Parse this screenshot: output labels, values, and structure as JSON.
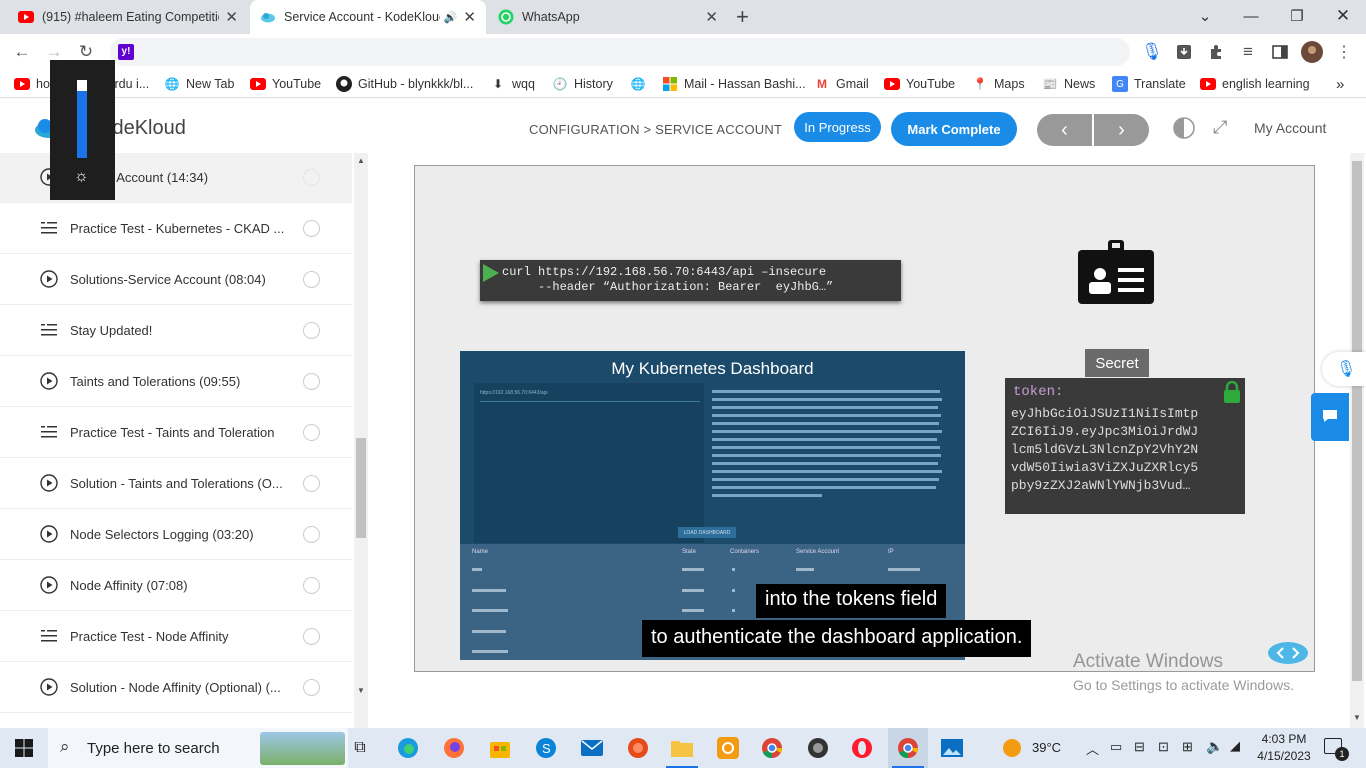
{
  "browser": {
    "tabs": [
      {
        "title": "(915) #haleem Eating Competitio",
        "active": false
      },
      {
        "title": "Service Account - KodeKloud",
        "active": true
      },
      {
        "title": "WhatsApp",
        "active": false
      }
    ],
    "new_tab": "+",
    "bookmarks": [
      "how to learn urdu i...",
      "New Tab",
      "YouTube",
      "GitHub - blynkkk/bl...",
      "wqq",
      "History",
      "Mail - Hassan Bashi...",
      "Gmail",
      "YouTube",
      "Maps",
      "News",
      "Translate",
      "english learning"
    ],
    "more": "»"
  },
  "header": {
    "logo": "KodeKloud",
    "breadcrumb": "CONFIGURATION > SERVICE ACCOUNT",
    "in_progress": "In Progress",
    "mark_complete": "Mark Complete",
    "prev": "‹",
    "next": "›",
    "account": "My Account"
  },
  "sidebar": {
    "items": [
      {
        "label": "Service Account (14:34)",
        "type": "video",
        "active": true
      },
      {
        "label": "Practice Test - Kubernetes - CKAD ...",
        "type": "test"
      },
      {
        "label": "Solutions-Service Account (08:04)",
        "type": "video"
      },
      {
        "label": "Stay Updated!",
        "type": "test"
      },
      {
        "label": "Taints and Tolerations (09:55)",
        "type": "video"
      },
      {
        "label": "Practice Test - Taints and Toleration",
        "type": "test"
      },
      {
        "label": "Solution - Taints and Tolerations (O...",
        "type": "video"
      },
      {
        "label": "Node Selectors Logging (03:20)",
        "type": "video"
      },
      {
        "label": "Node Affinity (07:08)",
        "type": "video"
      },
      {
        "label": "Practice Test - Node Affinity",
        "type": "test"
      },
      {
        "label": "Solution - Node Affinity (Optional) (...",
        "type": "video"
      }
    ]
  },
  "video": {
    "cmd1": "curl https://192.168.56.70:6443/api –insecure",
    "cmd2": "--header “Authorization: Bearer  eyJhbG…”",
    "dashboard_title": "My Kubernetes Dashboard",
    "dash_url": "https://192.168.56.70:6443/api",
    "load_btn": "LOAD DASHBOARD",
    "table_headers": [
      "Name",
      "State",
      "Containers",
      "Service Account",
      "IP"
    ],
    "secret_label": "Secret",
    "token_key": "token:",
    "token_lines": [
      "eyJhbGciOiJSUzI1NiIsImtp",
      "ZCI6IiJ9.eyJpc3MiOiJrdWJ",
      "lcm5ldGVzL3NlcnZpY2VhY2N",
      "vdW50Iiwia3ViZXJuZXRlcy5",
      "pby9zZXJ2aWNlYWNjb3Vud…"
    ],
    "subtitle1": "into the tokens field",
    "subtitle2": "to authenticate the dashboard application."
  },
  "watermark": {
    "line1": "Activate Windows",
    "line2": "Go to Settings to activate Windows."
  },
  "taskbar": {
    "search_placeholder": "Type here to search",
    "temp": "39°C",
    "time": "4:03 PM",
    "date": "4/15/2023",
    "notif": "1"
  },
  "colors": {
    "accent": "#1a8ce8",
    "tabbar": "#dee1e6",
    "taskbar": "#dfe8f3"
  }
}
